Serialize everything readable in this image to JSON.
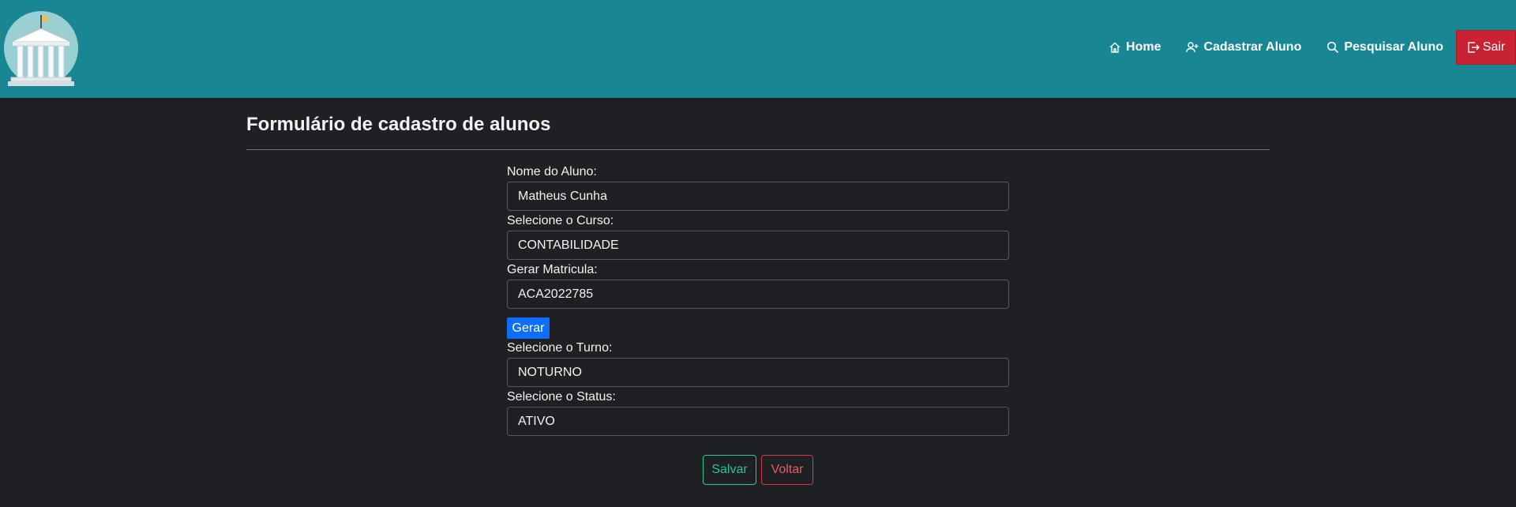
{
  "nav": {
    "home": "Home",
    "cadastrar": "Cadastrar Aluno",
    "pesquisar": "Pesquisar Aluno",
    "sair": "Sair"
  },
  "page": {
    "title": "Formulário de cadastro de alunos"
  },
  "form": {
    "nome_label": "Nome do Aluno:",
    "nome_value": "Matheus Cunha",
    "curso_label": "Selecione o Curso:",
    "curso_value": "CONTABILIDADE",
    "matricula_label": "Gerar Matricula:",
    "matricula_value": "ACA2022785",
    "gerar_label": "Gerar",
    "turno_label": "Selecione o Turno:",
    "turno_value": "NOTURNO",
    "status_label": "Selecione o Status:",
    "status_value": "ATIVO"
  },
  "actions": {
    "salvar": "Salvar",
    "voltar": "Voltar"
  },
  "icons": {
    "logo": "university-building-icon",
    "home": "home-icon",
    "cadastrar": "person-plus-icon",
    "pesquisar": "search-icon",
    "sair": "logout-icon"
  },
  "colors": {
    "navbar": "#198693",
    "background": "#1f2023",
    "danger": "#c82333",
    "primary": "#0d6efd",
    "success": "#20c997"
  }
}
